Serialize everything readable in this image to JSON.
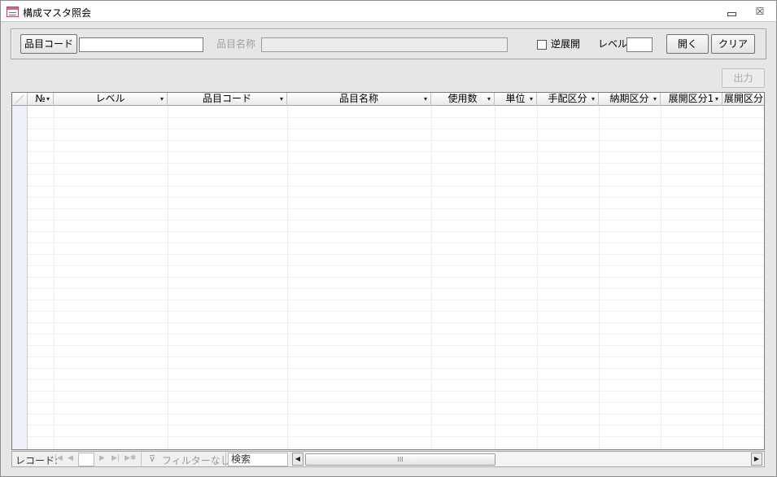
{
  "window": {
    "title": "構成マスタ照会",
    "minimize_symbol": "",
    "close_symbol": "☒"
  },
  "form": {
    "item_code_button": "品目コード",
    "item_code_value": "",
    "item_name_label": "品目名称",
    "item_name_value": "",
    "reverse_label": "逆展開",
    "reverse_checked": false,
    "level_label": "レベル",
    "level_value": "",
    "open_button": "開く",
    "clear_button": "クリア",
    "output_button": "出力"
  },
  "grid": {
    "columns": [
      {
        "label": "№",
        "arrow": "▾"
      },
      {
        "label": "レベル",
        "arrow": "▾"
      },
      {
        "label": "品目コード",
        "arrow": "▾"
      },
      {
        "label": "品目名称",
        "arrow": "▾"
      },
      {
        "label": "使用数",
        "arrow": "▾"
      },
      {
        "label": "単位",
        "arrow": "▾"
      },
      {
        "label": "手配区分",
        "arrow": "▾"
      },
      {
        "label": "納期区分",
        "arrow": "▾"
      },
      {
        "label": "展開区分1",
        "arrow": "▾"
      },
      {
        "label": "展開区分",
        "arrow": ""
      }
    ],
    "rows": []
  },
  "navigation": {
    "record_label": "レコード:",
    "first_icon": "|◀",
    "prev_icon": "◀",
    "next_icon": "▶",
    "last_icon": "▶|",
    "new_icon": "▶✱",
    "record_value": "",
    "filter_icon": "⊽",
    "filter_text": "フィルターなし",
    "search_label": "検索",
    "scroll_left": "◀",
    "scroll_right": "▶",
    "thumb_grip": "III"
  }
}
